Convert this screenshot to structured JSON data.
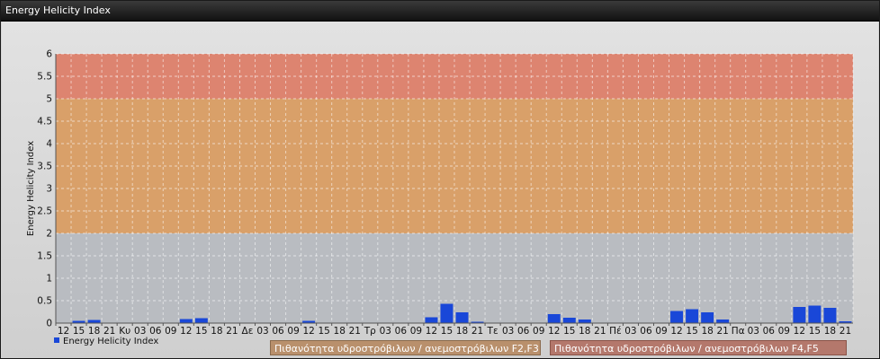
{
  "window": {
    "title": "Energy Helicity Index"
  },
  "chart_data": {
    "type": "bar",
    "title": "",
    "ylabel": "Energy Helicity Index",
    "xlabel": "",
    "ylim": [
      0,
      6
    ],
    "yticks": [
      0,
      0.5,
      1,
      1.5,
      2,
      2.5,
      3,
      3.5,
      4,
      4.5,
      5,
      5.5,
      6
    ],
    "ytick_labels": [
      "0",
      "0.5",
      "1",
      "1.5",
      "2",
      "2.5",
      "3",
      "3.5",
      "4",
      "4.5",
      "5",
      "5.5",
      "6"
    ],
    "grid": true,
    "categories": [
      "12",
      "15",
      "18",
      "21",
      "Κυ",
      "03",
      "06",
      "09",
      "12",
      "15",
      "18",
      "21",
      "Δε",
      "03",
      "06",
      "09",
      "12",
      "15",
      "18",
      "21",
      "Τρ",
      "03",
      "06",
      "09",
      "12",
      "15",
      "18",
      "21",
      "Τε",
      "03",
      "06",
      "09",
      "12",
      "15",
      "18",
      "21",
      "Πέ",
      "03",
      "06",
      "09",
      "12",
      "15",
      "18",
      "21",
      "Πα",
      "03",
      "06",
      "09",
      "12",
      "15",
      "18",
      "21"
    ],
    "series": [
      {
        "name": "Energy Helicity Index",
        "color": "#1947d8",
        "values": [
          0.01,
          0.05,
          0.07,
          0.01,
          0.01,
          0.01,
          0.01,
          0.01,
          0.09,
          0.11,
          0.01,
          0.01,
          0.01,
          0.01,
          0.01,
          0.01,
          0.05,
          0.01,
          0.01,
          0.01,
          0.01,
          0.01,
          0.01,
          0.01,
          0.13,
          0.43,
          0.24,
          0.03,
          0.01,
          0.01,
          0.01,
          0.01,
          0.2,
          0.12,
          0.08,
          0.01,
          0.01,
          0.01,
          0.01,
          0.01,
          0.27,
          0.31,
          0.24,
          0.08,
          0.01,
          0.01,
          0.01,
          0.01,
          0.36,
          0.39,
          0.34,
          0.04
        ]
      }
    ],
    "bands": [
      {
        "from": 0,
        "to": 2,
        "color": "#b9bcc1"
      },
      {
        "from": 2,
        "to": 5,
        "color": "#d9a069",
        "label": "Πιθανότητα υδροστρόβιλων / ανεμοστρόβιλων F2,F3"
      },
      {
        "from": 5,
        "to": 6,
        "color": "#dd8470",
        "label": "Πιθανότητα υδροστρόβιλων / ανεμοστρόβιλων F4,F5"
      }
    ],
    "legend_position": "bottom-left"
  }
}
